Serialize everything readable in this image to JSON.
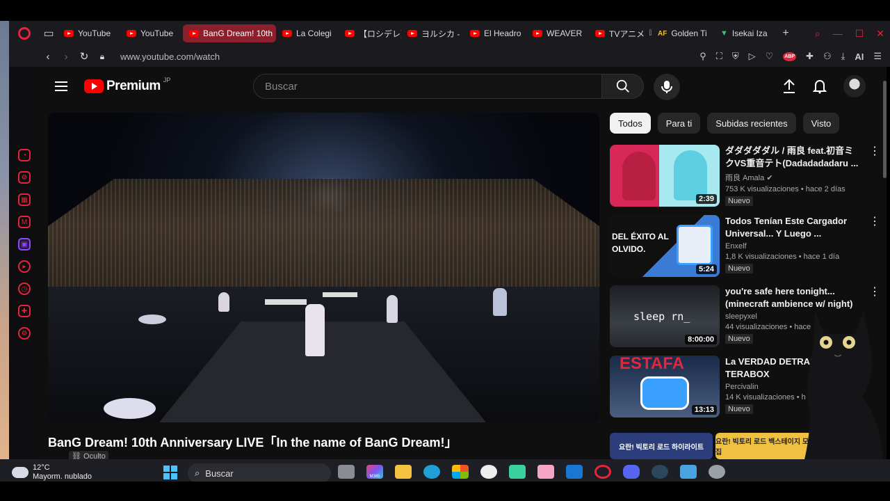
{
  "browser": {
    "tabs": [
      {
        "label": "YouTube",
        "active": false
      },
      {
        "label": "YouTube",
        "active": false
      },
      {
        "label": "BanG Dream! 10th",
        "active": true
      },
      {
        "label": "La Colegi",
        "active": false
      },
      {
        "label": "【ロシデレ】",
        "active": false
      },
      {
        "label": "ヨルシカ - ",
        "active": false
      },
      {
        "label": "El Headro",
        "active": false
      },
      {
        "label": "WEAVER",
        "active": false
      },
      {
        "label": "TVアニメ『",
        "active": false
      },
      {
        "label": "Golden Ti",
        "active": false
      },
      {
        "label": "Isekai Iza",
        "active": false
      }
    ],
    "url": "www.youtube.com/watch",
    "ai_label": "AI",
    "abp_label": "ABP"
  },
  "youtube": {
    "logo_text": "Premium",
    "logo_region": "JP",
    "search_placeholder": "Buscar",
    "video_title": "BanG Dream! 10th Anniversary LIVE「In the name of BanG Dream!」",
    "visibility": "Oculto",
    "chips": [
      "Todos",
      "Para ti",
      "Subidas recientes",
      "Visto"
    ],
    "recommendations": [
      {
        "title": "ダダダダダル / 雨良 feat.初音ミクVS重音テト(Dadadadadaru ...",
        "channel": "雨良 Amala",
        "verified": true,
        "meta": "753 K visualizaciones • hace 2 días",
        "badge": "Nuevo",
        "duration": "2:39",
        "thumb_text": ""
      },
      {
        "title": "Todos Tenían Este Cargador Universal... Y Luego ...",
        "channel": "Enxelf",
        "verified": false,
        "meta": "1,8 K visualizaciones • hace 1 día",
        "badge": "Nuevo",
        "duration": "5:24",
        "thumb_text": "DEL ÉXITO AL OLVIDO."
      },
      {
        "title": "you're safe here tonight... (minecraft ambience w/ night)",
        "channel": "sleepyxel",
        "verified": false,
        "meta": "44 visualizaciones • hace",
        "badge": "Nuevo",
        "duration": "8:00:00",
        "thumb_text": "sleep rn_"
      },
      {
        "title": "La VERDAD DETRAS de TERABOX",
        "channel": "Percivalin",
        "verified": false,
        "meta": "14 K visualizaciones • h",
        "badge": "Nuevo",
        "duration": "13:13",
        "thumb_text": "ESTAFA"
      }
    ],
    "strip": [
      "요란! 빅토리 로드 하이라이트",
      "요란! 빅토리 로드 백스테이지 모음집"
    ]
  },
  "taskbar": {
    "temperature": "12°C",
    "condition": "Mayorm. nublado",
    "search_placeholder": "Buscar",
    "m365_label": "M365"
  },
  "colors": {
    "opera_red": "#e8243a",
    "yt_red": "#ff0000",
    "page_bg": "#0f0f0f"
  }
}
